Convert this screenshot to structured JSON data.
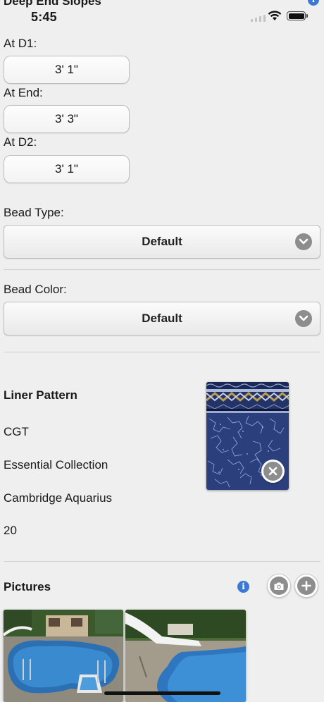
{
  "status_bar": {
    "time": "5:45"
  },
  "section_title": "Deep End Slopes",
  "slopes": {
    "at_d1_label": "At D1:",
    "at_d1_value": "3' 1\"",
    "at_end_label": "At End:",
    "at_end_value": "3' 3\"",
    "at_d2_label": "At D2:",
    "at_d2_value": "3' 1\""
  },
  "bead_type": {
    "label": "Bead Type:",
    "value": "Default"
  },
  "bead_color": {
    "label": "Bead Color:",
    "value": "Default"
  },
  "liner": {
    "heading": "Liner Pattern",
    "manufacturer": "CGT",
    "collection": "Essential Collection",
    "pattern": "Cambridge Aquarius",
    "gauge": "20"
  },
  "pictures": {
    "heading": "Pictures"
  },
  "icons": {
    "info": "info-icon",
    "camera": "camera-icon",
    "add": "plus-icon",
    "remove": "close-icon",
    "chevron": "chevron-down-icon"
  },
  "colors": {
    "background": "#efefef",
    "accent": "#3a7ad4",
    "control_gray": "#8d8d8d"
  }
}
